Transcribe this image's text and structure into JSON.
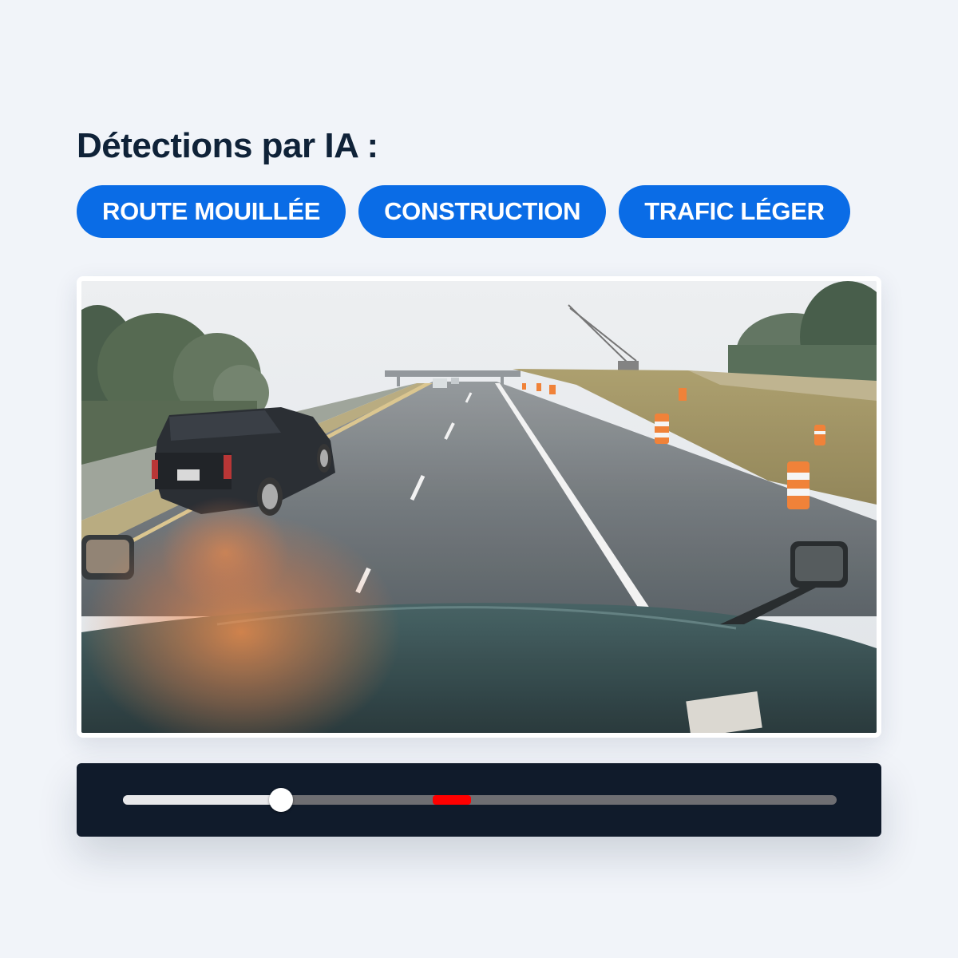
{
  "heading": "Détections par IA :",
  "tags": [
    {
      "label": "ROUTE MOUILLÉE"
    },
    {
      "label": "CONSTRUCTION"
    },
    {
      "label": "TRAFIC LÉGER"
    }
  ],
  "colors": {
    "accent": "#0a6ce6",
    "heading_text": "#0f2238",
    "player_background": "#101b2b",
    "event_marker": "#ff0000"
  },
  "player": {
    "progress": 0.222,
    "event_marker_position": 0.434
  },
  "icons": [
    "slider-thumb",
    "event-marker"
  ]
}
